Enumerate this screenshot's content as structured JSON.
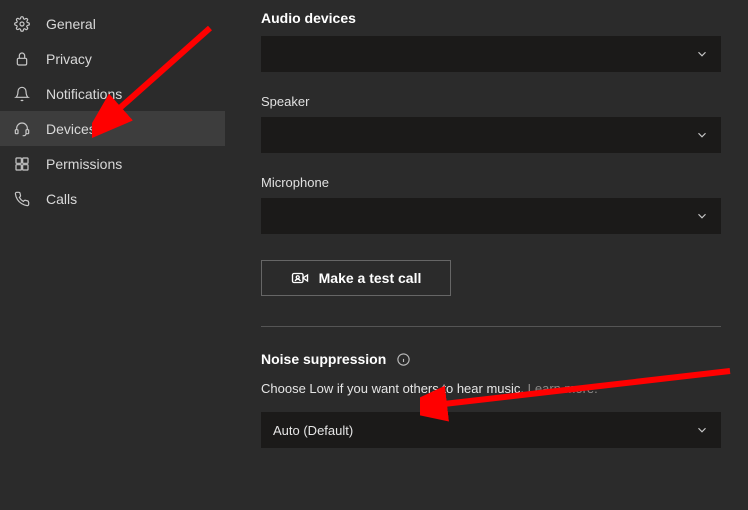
{
  "sidebar": {
    "items": [
      {
        "icon": "gear-icon",
        "label": "General"
      },
      {
        "icon": "lock-icon",
        "label": "Privacy"
      },
      {
        "icon": "bell-icon",
        "label": "Notifications"
      },
      {
        "icon": "headset-icon",
        "label": "Devices"
      },
      {
        "icon": "permissions-icon",
        "label": "Permissions"
      },
      {
        "icon": "call-icon",
        "label": "Calls"
      }
    ],
    "active_index": 3
  },
  "main": {
    "audio_devices": {
      "heading": "Audio devices",
      "value": ""
    },
    "speaker": {
      "label": "Speaker",
      "value": ""
    },
    "microphone": {
      "label": "Microphone",
      "value": ""
    },
    "test_call_label": "Make a test call",
    "noise_suppression": {
      "heading": "Noise suppression",
      "helper": "Choose Low if you want others to hear music.",
      "learn_more": "Learn more.",
      "value": "Auto (Default)"
    }
  },
  "colors": {
    "annotation": "#ff0000"
  }
}
